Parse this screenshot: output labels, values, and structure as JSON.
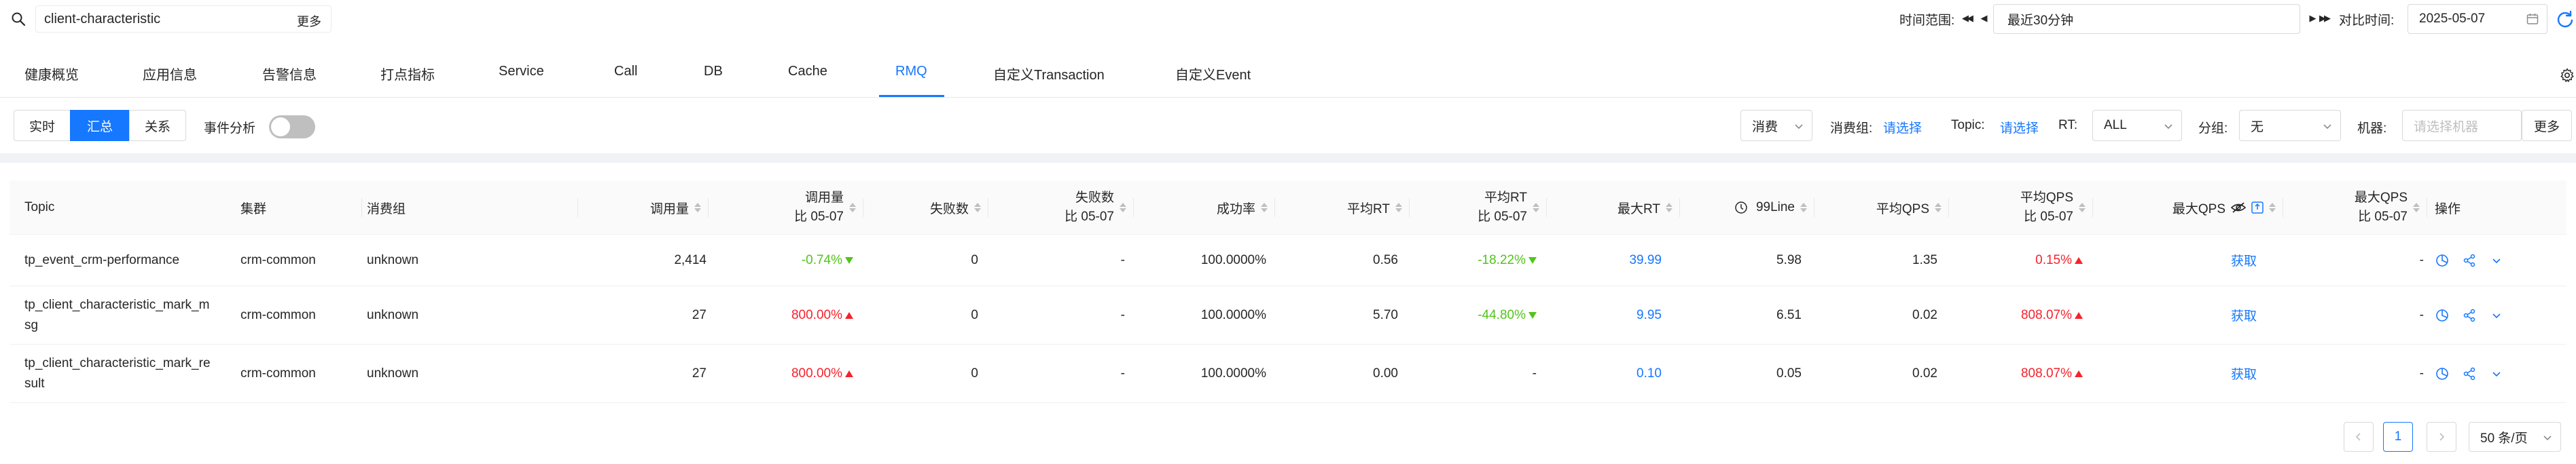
{
  "search": {
    "value": "client-characteristic",
    "more_label": "更多"
  },
  "time": {
    "label": "时间范围:",
    "range_value": "最近30分钟",
    "compare_label": "对比时间:",
    "compare_date": "2025-05-07"
  },
  "tabs": [
    {
      "label": "健康概览"
    },
    {
      "label": "应用信息"
    },
    {
      "label": "告警信息"
    },
    {
      "label": "打点指标"
    },
    {
      "label": "Service"
    },
    {
      "label": "Call"
    },
    {
      "label": "DB"
    },
    {
      "label": "Cache"
    },
    {
      "label": "RMQ"
    },
    {
      "label": "自定义Transaction"
    },
    {
      "label": "自定义Event"
    }
  ],
  "active_tab": "RMQ",
  "view_modes": [
    {
      "label": "实时"
    },
    {
      "label": "汇总"
    },
    {
      "label": "关系"
    }
  ],
  "active_view_mode": "汇总",
  "event_analysis": {
    "label": "事件分析",
    "enabled": false
  },
  "filters": {
    "type_value": "消费",
    "consumer_group_label": "消费组:",
    "consumer_group_link": "请选择",
    "topic_label": "Topic:",
    "topic_link": "请选择",
    "rt_label": "RT:",
    "rt_value": "ALL",
    "group_label": "分组:",
    "group_value": "无",
    "machine_label": "机器:",
    "machine_placeholder": "请选择机器",
    "more_label": "更多"
  },
  "table": {
    "headers": {
      "topic": "Topic",
      "cluster": "集群",
      "consumer_group": "消费组",
      "calls": "调用量",
      "calls_cmp_1": "调用量",
      "calls_cmp_2": "比 05-07",
      "failures": "失败数",
      "failures_cmp_1": "失败数",
      "failures_cmp_2": "比 05-07",
      "success_rate": "成功率",
      "avg_rt": "平均RT",
      "avg_rt_cmp_1": "平均RT",
      "avg_rt_cmp_2": "比 05-07",
      "max_rt": "最大RT",
      "line99": "99Line",
      "avg_qps": "平均QPS",
      "avg_qps_cmp_1": "平均QPS",
      "avg_qps_cmp_2": "比 05-07",
      "max_qps": "最大QPS",
      "max_qps_cmp_1": "最大QPS",
      "max_qps_cmp_2": "比 05-07",
      "ops": "操作"
    },
    "rows": [
      {
        "topic": "tp_event_crm-performance",
        "cluster": "crm-common",
        "consumer_group": "unknown",
        "calls": "2,414",
        "calls_cmp": "-0.74%",
        "calls_cmp_dir": "down",
        "failures": "0",
        "failures_cmp": "-",
        "success_rate": "100.0000%",
        "avg_rt": "0.56",
        "avg_rt_cmp": "-18.22%",
        "avg_rt_cmp_dir": "down",
        "max_rt": "39.99",
        "line99": "5.98",
        "avg_qps": "1.35",
        "avg_qps_cmp": "0.15%",
        "avg_qps_cmp_dir": "up",
        "max_qps": "获取",
        "max_qps_cmp": "-"
      },
      {
        "topic": "tp_client_characteristic_mark_msg",
        "topic_line1": "tp_client_characteristic_mark_m",
        "topic_line2": "sg",
        "cluster": "crm-common",
        "consumer_group": "unknown",
        "calls": "27",
        "calls_cmp": "800.00%",
        "calls_cmp_dir": "up",
        "failures": "0",
        "failures_cmp": "-",
        "success_rate": "100.0000%",
        "avg_rt": "5.70",
        "avg_rt_cmp": "-44.80%",
        "avg_rt_cmp_dir": "down",
        "max_rt": "9.95",
        "line99": "6.51",
        "avg_qps": "0.02",
        "avg_qps_cmp": "808.07%",
        "avg_qps_cmp_dir": "up",
        "max_qps": "获取",
        "max_qps_cmp": "-"
      },
      {
        "topic": "tp_client_characteristic_mark_result",
        "topic_line1": "tp_client_characteristic_mark_re",
        "topic_line2": "sult",
        "cluster": "crm-common",
        "consumer_group": "unknown",
        "calls": "27",
        "calls_cmp": "800.00%",
        "calls_cmp_dir": "up",
        "failures": "0",
        "failures_cmp": "-",
        "success_rate": "100.0000%",
        "avg_rt": "0.00",
        "avg_rt_cmp": "-",
        "avg_rt_cmp_dir": "none",
        "max_rt": "0.10",
        "line99": "0.05",
        "avg_qps": "0.02",
        "avg_qps_cmp": "808.07%",
        "avg_qps_cmp_dir": "up",
        "max_qps": "获取",
        "max_qps_cmp": "-"
      }
    ]
  },
  "pagination": {
    "current_page": "1",
    "page_size": "50 条/页"
  },
  "colors": {
    "accent": "#1677ff",
    "increase": "#f5222d",
    "decrease": "#52c41a"
  },
  "icons": [
    "search-icon",
    "double-left-icon",
    "caret-left-icon",
    "caret-right-icon",
    "double-right-icon",
    "calendar-icon",
    "refresh-icon",
    "gear-icon",
    "chevron-down-icon",
    "clock-icon",
    "eye-off-icon",
    "export-icon",
    "chart-icon",
    "share-icon"
  ]
}
